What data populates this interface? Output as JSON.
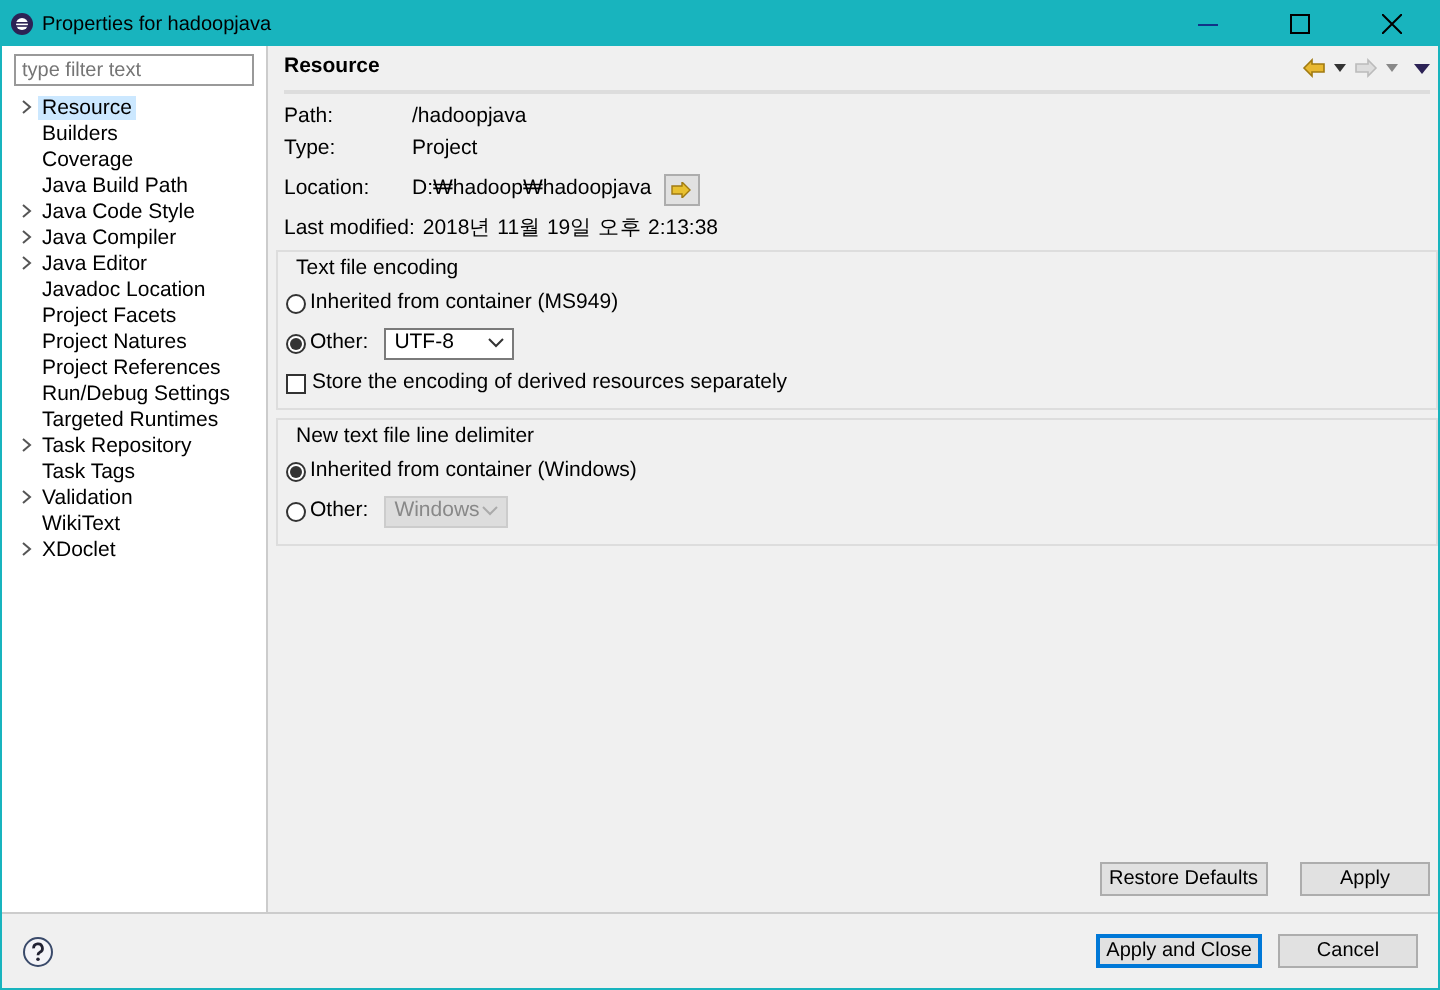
{
  "window": {
    "title": "Properties for hadoopjava"
  },
  "filter": {
    "placeholder": "type filter text"
  },
  "tree": [
    {
      "label": "Resource",
      "expandable": true,
      "selected": true
    },
    {
      "label": "Builders",
      "expandable": false,
      "selected": false
    },
    {
      "label": "Coverage",
      "expandable": false,
      "selected": false
    },
    {
      "label": "Java Build Path",
      "expandable": false,
      "selected": false
    },
    {
      "label": "Java Code Style",
      "expandable": true,
      "selected": false
    },
    {
      "label": "Java Compiler",
      "expandable": true,
      "selected": false
    },
    {
      "label": "Java Editor",
      "expandable": true,
      "selected": false
    },
    {
      "label": "Javadoc Location",
      "expandable": false,
      "selected": false
    },
    {
      "label": "Project Facets",
      "expandable": false,
      "selected": false
    },
    {
      "label": "Project Natures",
      "expandable": false,
      "selected": false
    },
    {
      "label": "Project References",
      "expandable": false,
      "selected": false
    },
    {
      "label": "Run/Debug Settings",
      "expandable": false,
      "selected": false
    },
    {
      "label": "Targeted Runtimes",
      "expandable": false,
      "selected": false
    },
    {
      "label": "Task Repository",
      "expandable": true,
      "selected": false
    },
    {
      "label": "Task Tags",
      "expandable": false,
      "selected": false
    },
    {
      "label": "Validation",
      "expandable": true,
      "selected": false
    },
    {
      "label": "WikiText",
      "expandable": false,
      "selected": false
    },
    {
      "label": "XDoclet",
      "expandable": true,
      "selected": false
    }
  ],
  "page": {
    "title": "Resource",
    "back_enabled": true,
    "forward_enabled": false
  },
  "info": [
    {
      "label": "Path:",
      "value": "/hadoopjava",
      "kind": "text"
    },
    {
      "label": "Type:",
      "value": "Project",
      "kind": "text"
    },
    {
      "label": "Location:",
      "value": "D:₩hadoop₩hadoopjava",
      "kind": "location"
    },
    {
      "label": "Last modified:",
      "value": "2018년 11월 19일 오후 2:13:38",
      "kind": "text"
    }
  ],
  "groups": [
    {
      "title": "Text file encoding",
      "options": [
        {
          "label": "Inherited from container (MS949)",
          "selected": false
        },
        {
          "label": "Other:",
          "selected": true,
          "combo": "UTF-8",
          "disabled": false
        }
      ],
      "checkbox": {
        "label": "Store the encoding of derived resources separately",
        "checked": false
      }
    },
    {
      "title": "New text file line delimiter",
      "options": [
        {
          "label": "Inherited from container (Windows)",
          "selected": true
        },
        {
          "label": "Other:",
          "selected": false,
          "combo": "Windows",
          "disabled": true
        }
      ]
    }
  ],
  "page_buttons": [
    "Restore Defaults",
    "Apply"
  ],
  "dialog_buttons": [
    {
      "label": "Apply and Close",
      "default": true
    },
    {
      "label": "Cancel",
      "default": false
    }
  ]
}
